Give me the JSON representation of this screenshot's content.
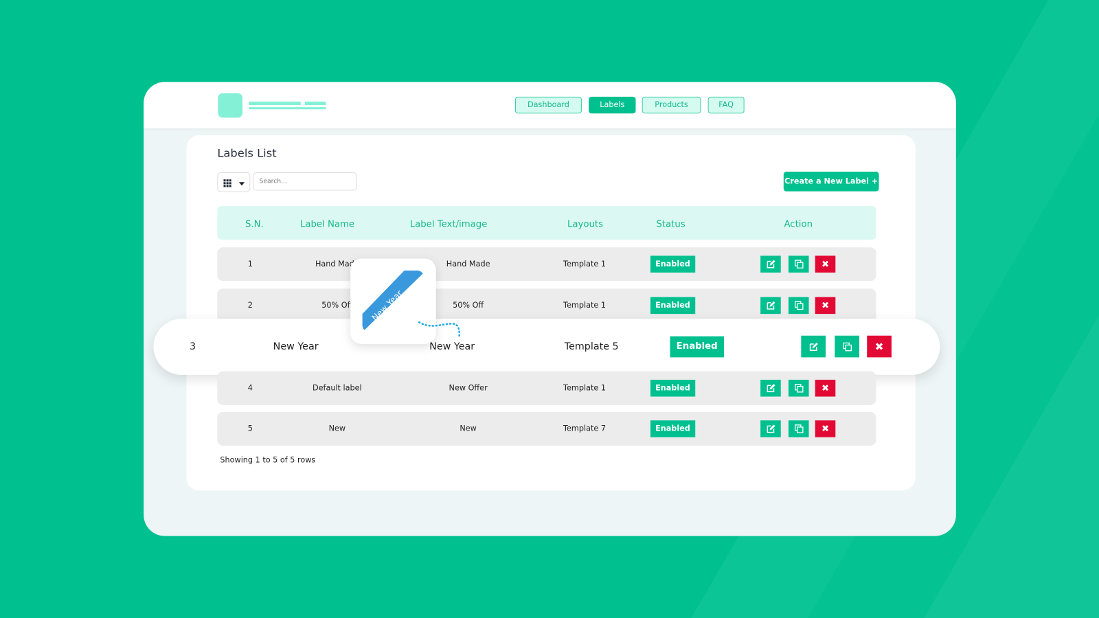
{
  "nav": {
    "items": [
      {
        "label": "Dashboard"
      },
      {
        "label": "Labels",
        "active": true
      },
      {
        "label": "Products"
      },
      {
        "label": "FAQ"
      }
    ]
  },
  "page": {
    "title": "Labels List",
    "search_placeholder": "Search...",
    "create_label": "Create a New Label +",
    "grid_icon": "grid-icon",
    "footer": "Showing 1 to 5 of 5 rows"
  },
  "table": {
    "headers": [
      "S.N.",
      "Label Name",
      "Label Text/image",
      "Layouts",
      "Status",
      "Action"
    ],
    "rows": [
      {
        "sn": "1",
        "name": "Hand Made",
        "text": "Hand Made",
        "layout": "Template 1",
        "status": "Enabled"
      },
      {
        "sn": "2",
        "name": "50% Off",
        "text": "50% Off",
        "layout": "Template 1",
        "status": "Enabled"
      },
      {
        "sn": "3",
        "name": "New Year",
        "text": "New Year",
        "layout": "Template 5",
        "status": "Enabled",
        "highlighted": true
      },
      {
        "sn": "4",
        "name": "Default label",
        "text": "New  Offer",
        "layout": "Template 1",
        "status": "Enabled"
      },
      {
        "sn": "5",
        "name": "New",
        "text": "New",
        "layout": "Template 7",
        "status": "Enabled"
      }
    ]
  },
  "preview": {
    "ribbon_text": "New Year",
    "ribbon_color": "#3a98dc"
  },
  "colors": {
    "brand": "#00c08f",
    "danger": "#e20a35",
    "header_bg": "#dbf9f2"
  }
}
